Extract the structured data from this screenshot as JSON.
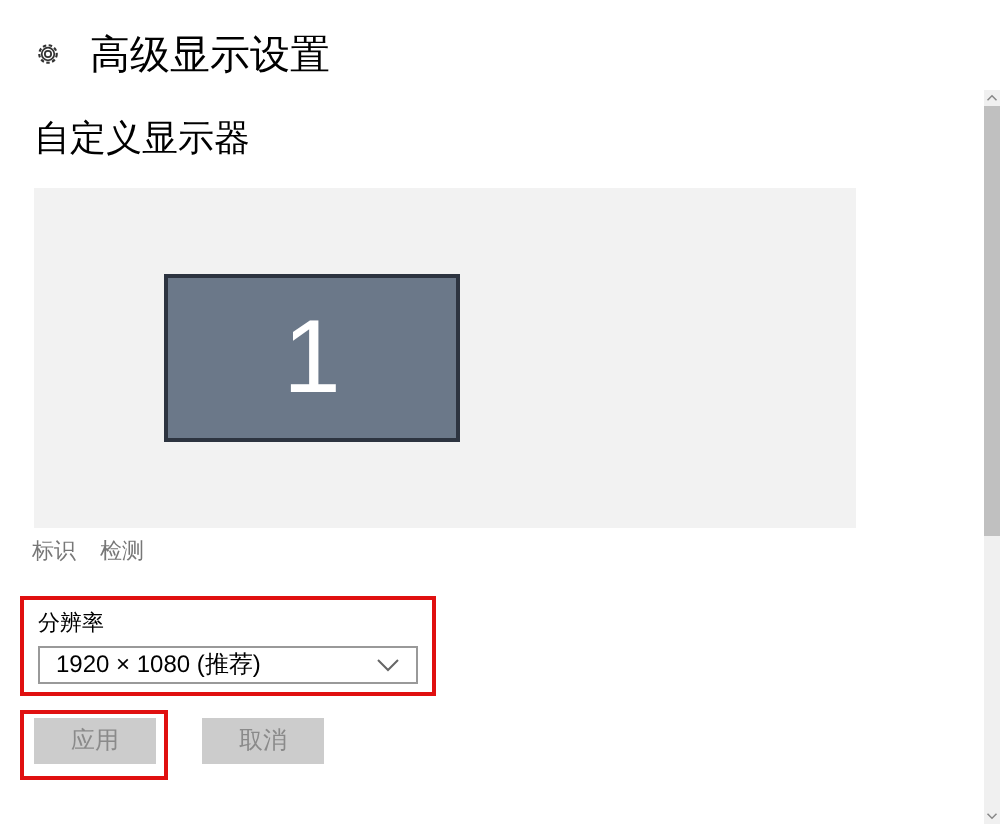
{
  "page": {
    "title": "高级显示设置"
  },
  "section": {
    "heading": "自定义显示器"
  },
  "monitors": [
    {
      "number": "1",
      "selected": true
    }
  ],
  "links": [
    {
      "label": "标识",
      "disabled": true
    },
    {
      "label": "检测",
      "disabled": true
    }
  ],
  "resolution": {
    "label": "分辨率",
    "value": "1920 × 1080 (推荐)",
    "highlighted": true
  },
  "buttons": [
    {
      "label": "应用",
      "disabled": true,
      "highlighted": true
    },
    {
      "label": "取消",
      "disabled": true,
      "highlighted": false
    }
  ]
}
